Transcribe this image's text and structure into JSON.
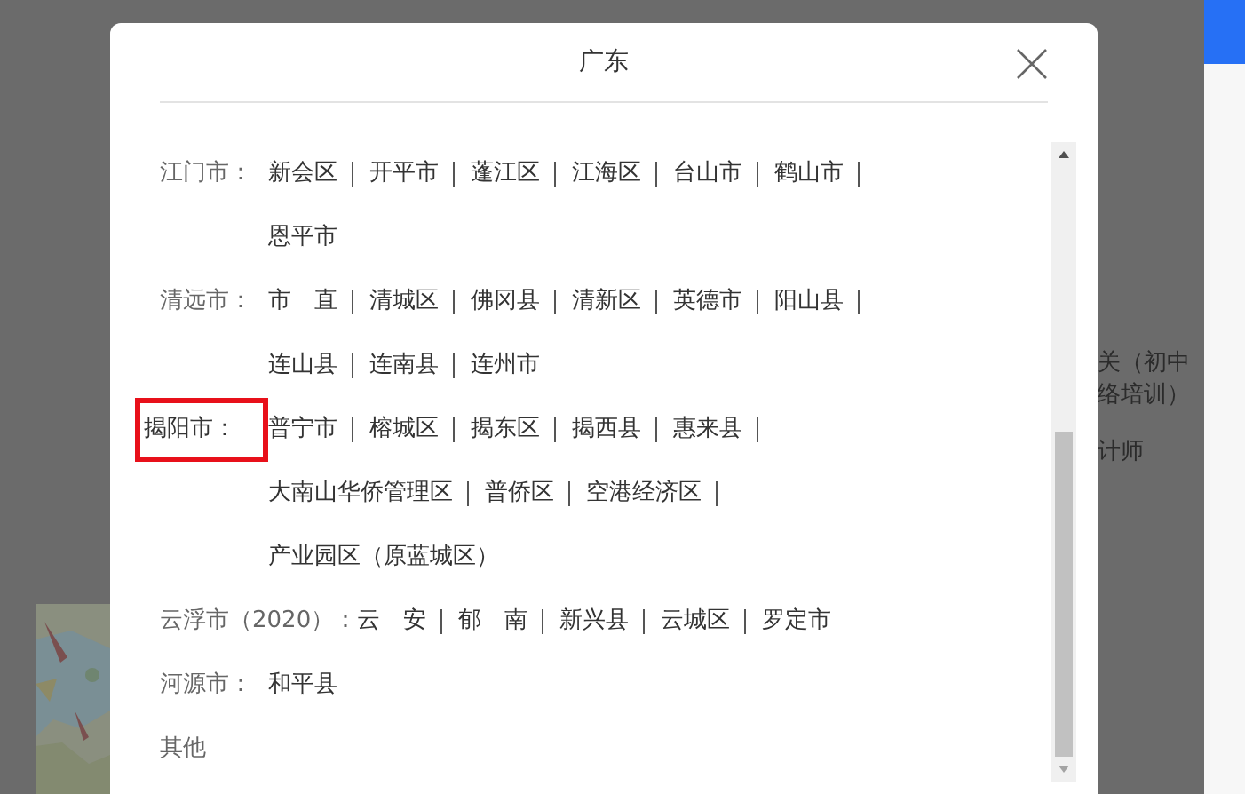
{
  "dialog": {
    "title": "广东",
    "cities": [
      {
        "name": "江门市：",
        "highlighted": false,
        "lines": [
          [
            {
              "name": "新会区",
              "sep": true
            },
            {
              "name": "开平市",
              "sep": true
            },
            {
              "name": "蓬江区",
              "sep": true
            },
            {
              "name": "江海区",
              "sep": true
            },
            {
              "name": "台山市",
              "sep": true
            },
            {
              "name": "鹤山市",
              "sep": true
            }
          ],
          [
            {
              "name": "恩平市",
              "sep": false
            }
          ]
        ]
      },
      {
        "name": "清远市：",
        "highlighted": false,
        "lines": [
          [
            {
              "name": "市　直",
              "sep": true
            },
            {
              "name": "清城区",
              "sep": true
            },
            {
              "name": "佛冈县",
              "sep": true
            },
            {
              "name": "清新区",
              "sep": true
            },
            {
              "name": "英德市",
              "sep": true
            },
            {
              "name": "阳山县",
              "sep": true
            }
          ],
          [
            {
              "name": "连山县",
              "sep": true
            },
            {
              "name": "连南县",
              "sep": true
            },
            {
              "name": "连州市",
              "sep": false
            }
          ]
        ]
      },
      {
        "name": "揭阳市：",
        "highlighted": true,
        "lines": [
          [
            {
              "name": "普宁市",
              "sep": true
            },
            {
              "name": "榕城区",
              "sep": true
            },
            {
              "name": "揭东区",
              "sep": true
            },
            {
              "name": "揭西县",
              "sep": true
            },
            {
              "name": "惠来县",
              "sep": true
            }
          ],
          [
            {
              "name": "大南山华侨管理区",
              "sep": true
            },
            {
              "name": "普侨区",
              "sep": true
            },
            {
              "name": "空港经济区",
              "sep": true
            }
          ],
          [
            {
              "name": "产业园区（原蓝城区）",
              "sep": false
            }
          ]
        ]
      },
      {
        "name": "云浮市（2020）：",
        "highlighted": false,
        "lines": [
          [
            {
              "name": "云　安",
              "sep": true
            },
            {
              "name": "郁　南",
              "sep": true
            },
            {
              "name": "新兴县",
              "sep": true
            },
            {
              "name": "云城区",
              "sep": true
            },
            {
              "name": "罗定市",
              "sep": false
            }
          ]
        ]
      },
      {
        "name": "河源市：",
        "highlighted": false,
        "lines": [
          [
            {
              "name": "和平县",
              "sep": false
            }
          ]
        ]
      },
      {
        "name": "其他",
        "highlighted": false
      }
    ]
  },
  "background_texts": [
    "关（初中",
    "络培训）",
    "计师"
  ]
}
